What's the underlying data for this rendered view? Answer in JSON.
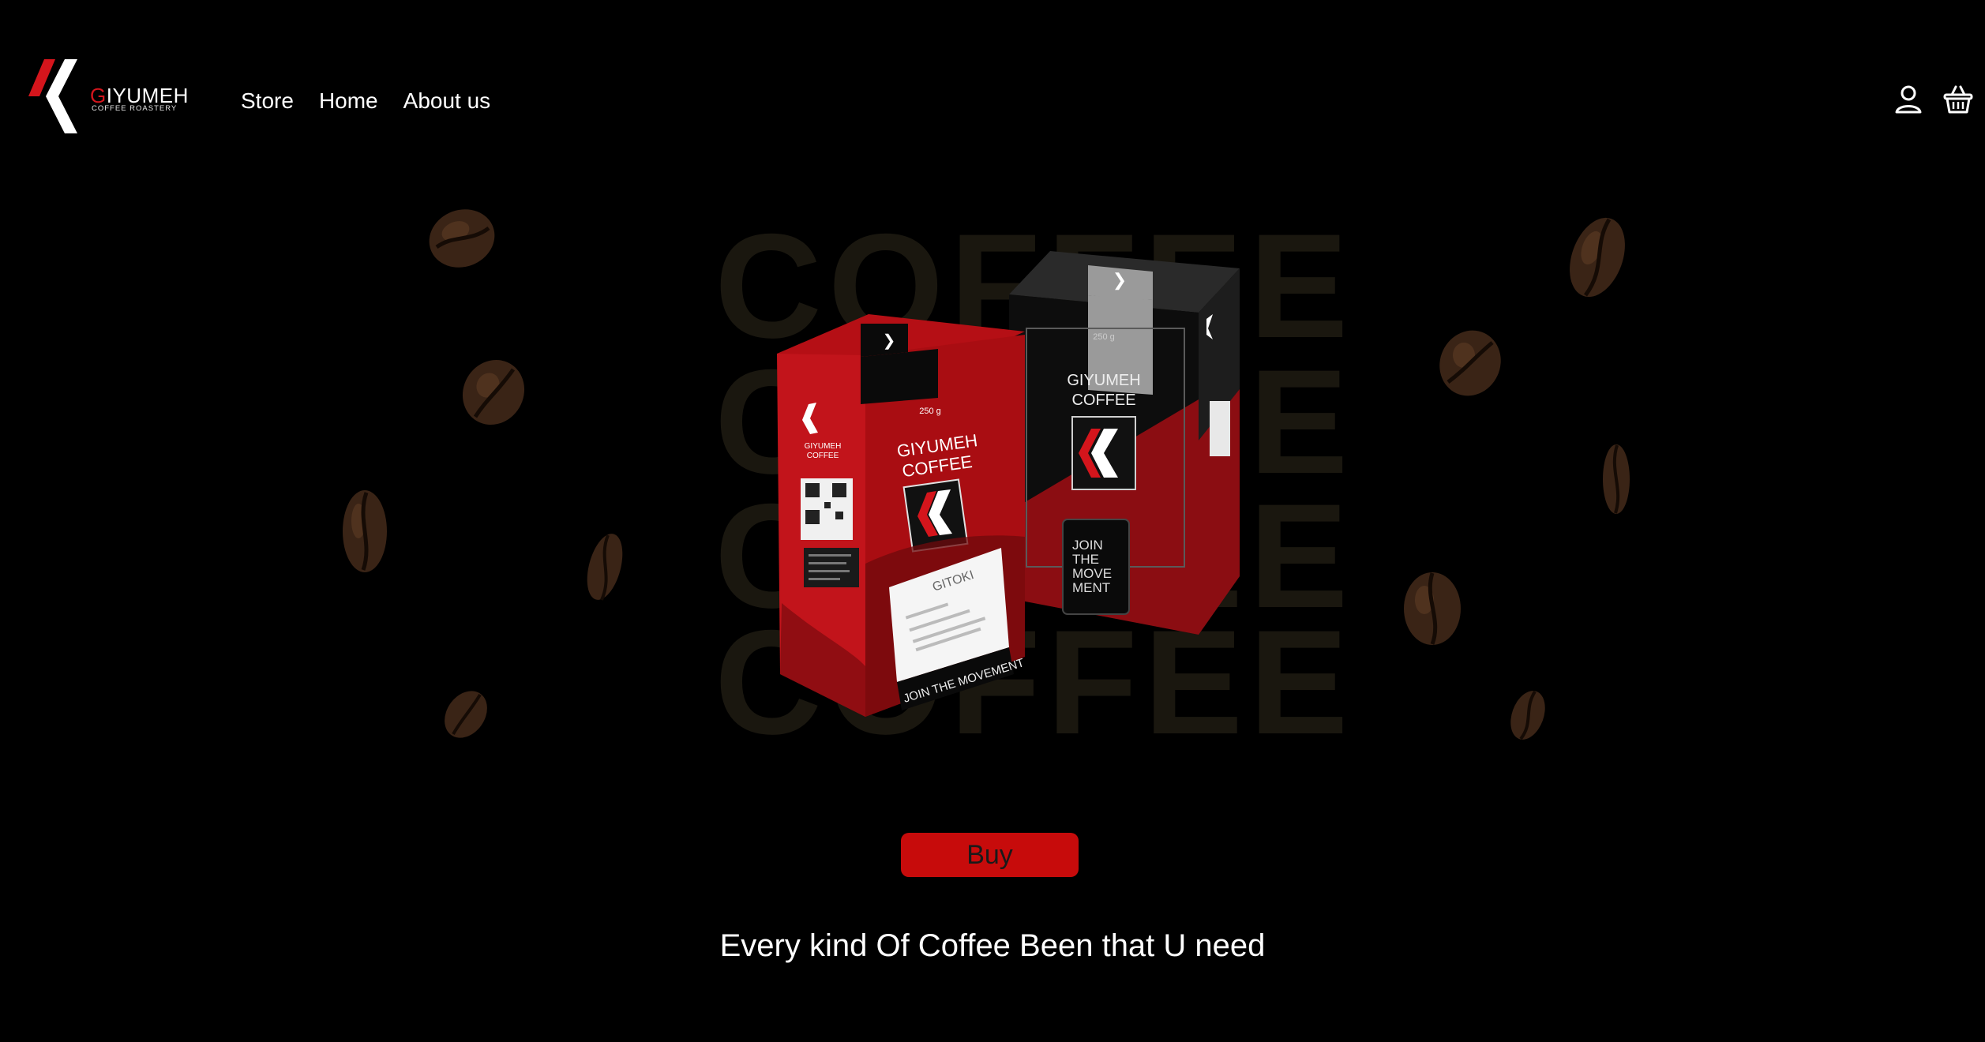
{
  "brand": {
    "name_initial": "G",
    "name_rest": "IYUMEH",
    "subtitle": "COFFEE ROASTERY",
    "accent": "#d4151c"
  },
  "nav": {
    "items": [
      {
        "label": "Store"
      },
      {
        "label": "Home"
      },
      {
        "label": "About us"
      }
    ]
  },
  "header_icons": [
    "user-icon",
    "basket-icon"
  ],
  "hero": {
    "background_word": "COFFEE",
    "red_box": {
      "weight": "250 g",
      "name_line1": "GIYUMEH",
      "name_line2": "COFFEE",
      "side_name1": "GIYUMEH",
      "side_name2": "COFFEE",
      "label_title": "GITOKI",
      "slogan": "JOIN THE MOVEMENT"
    },
    "black_box": {
      "weight": "250 g",
      "name_line1": "GIYUMEH",
      "name_line2": "COFFEE",
      "slogan_line1": "JOIN",
      "slogan_line2": "THE",
      "slogan_line3": "MOVE",
      "slogan_line4": "MENT"
    }
  },
  "cta": {
    "buy_label": "Buy",
    "color": "#c70b0b"
  },
  "tagline": "Every kind Of Coffee Been that U need"
}
